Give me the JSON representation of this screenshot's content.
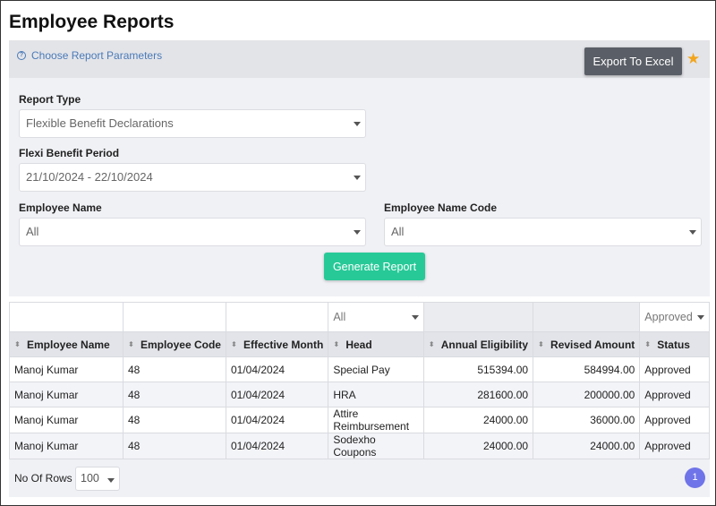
{
  "page": {
    "title": "Employee Reports"
  },
  "params": {
    "choose_label": "Choose Report Parameters",
    "export_label": "Export To Excel",
    "report_type": {
      "label": "Report Type",
      "value": "Flexible Benefit Declarations"
    },
    "flexi_period": {
      "label": "Flexi Benefit Period",
      "value": "21/10/2024 - 22/10/2024"
    },
    "employee_name": {
      "label": "Employee Name",
      "value": "All"
    },
    "employee_code": {
      "label": "Employee Name Code",
      "value": "All"
    },
    "generate_label": "Generate Report"
  },
  "grid": {
    "filters": {
      "head": "All",
      "status": "Approved"
    },
    "columns": [
      "Employee Name",
      "Employee Code",
      "Effective Month",
      "Head",
      "Annual Eligibility",
      "Revised Amount",
      "Status"
    ],
    "rows": [
      [
        "Manoj Kumar",
        "48",
        "01/04/2024",
        "Special Pay",
        "515394.00",
        "584994.00",
        "Approved"
      ],
      [
        "Manoj Kumar",
        "48",
        "01/04/2024",
        "HRA",
        "281600.00",
        "200000.00",
        "Approved"
      ],
      [
        "Manoj Kumar",
        "48",
        "01/04/2024",
        "Attire Reimbursement",
        "24000.00",
        "36000.00",
        "Approved"
      ],
      [
        "Manoj Kumar",
        "48",
        "01/04/2024",
        "Sodexho Coupons",
        "24000.00",
        "24000.00",
        "Approved"
      ]
    ],
    "rows_label": "No Of Rows :",
    "rows_value": "100",
    "current_page": "1"
  },
  "colors": {
    "accent_green": "#27c997",
    "export_gray": "#5a5e66",
    "star": "#f2a51c",
    "page_badge": "#6f74e8"
  }
}
